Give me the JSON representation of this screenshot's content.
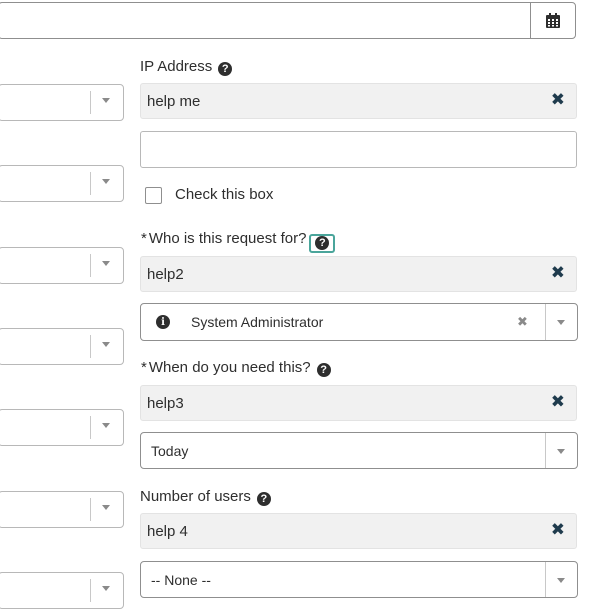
{
  "date_field": {
    "icon": "calendar-icon",
    "value": ""
  },
  "fields": {
    "ip_address": {
      "label": "IP Address",
      "help_text": "help me",
      "value": ""
    },
    "checkbox": {
      "label": "Check this box",
      "checked": false
    },
    "requested_for": {
      "required_mark": "*",
      "label": "Who is this request for?",
      "help_text": "help2",
      "value": "System Administrator"
    },
    "when_needed": {
      "required_mark": "*",
      "label": "When do you need this?",
      "help_text": "help3",
      "value": "Today"
    },
    "number_of_users": {
      "label": "Number of users",
      "help_text": "help 4",
      "value": "-- None --"
    }
  },
  "icons": {
    "help": "?",
    "close": "✖",
    "clear": "✖",
    "info": "i"
  },
  "colors": {
    "help_focus_border": "#4aa59b",
    "close_icon": "#1f3b4d",
    "help_bg": "#f1f1f1"
  }
}
